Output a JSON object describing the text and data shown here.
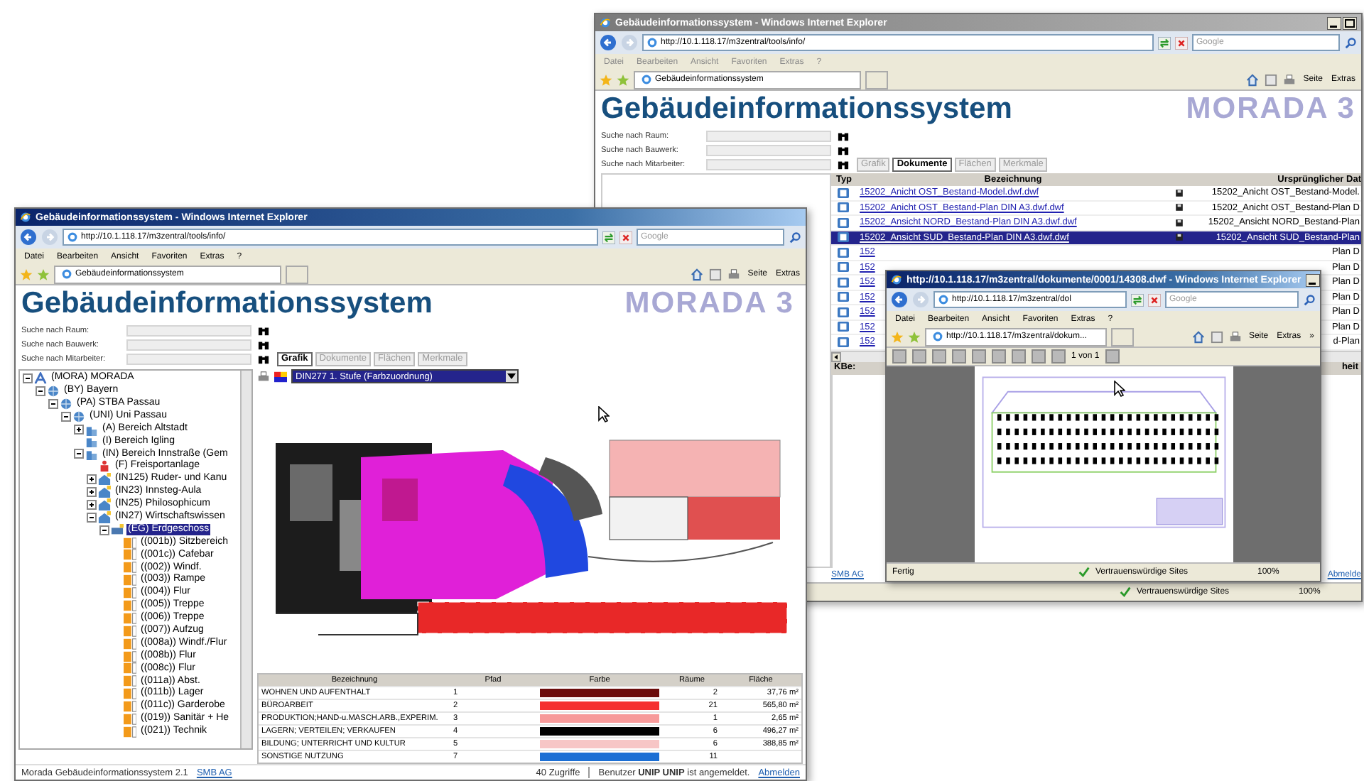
{
  "back_window": {
    "title": "Gebäudeinformationssystem - Windows Internet Explorer",
    "active": false,
    "address": "http://10.1.118.17/m3zentral/tools/info/",
    "search_placeholder": "Google",
    "menu": [
      "Datei",
      "Bearbeiten",
      "Ansicht",
      "Favoriten",
      "Extras",
      "?"
    ],
    "page_tab": "Gebäudeinformationssystem",
    "toolbar": [
      "Seite",
      "Extras"
    ],
    "page": {
      "heading": "Gebäudeinformationssystem",
      "logo": "MORADA 3",
      "search": [
        {
          "label": "Suche nach Raum:"
        },
        {
          "label": "Suche nach Bauwerk:"
        },
        {
          "label": "Suche nach Mitarbeiter:"
        }
      ],
      "tabs": [
        {
          "label": "Grafik",
          "selected": false
        },
        {
          "label": "Dokumente",
          "selected": true
        },
        {
          "label": "Flächen",
          "selected": false
        },
        {
          "label": "Merkmale",
          "selected": false
        }
      ],
      "documents": {
        "columns": [
          "Typ",
          "Bezeichnung",
          "Ursprünglicher Dat"
        ],
        "rows": [
          {
            "name": "15202_Anicht OST_Bestand-Model.dwf.dwf",
            "original": "15202_Anicht OST_Bestand-Model.",
            "selected": false
          },
          {
            "name": "15202_Anicht OST_Bestand-Plan DIN A3.dwf.dwf",
            "original": "15202_Anicht OST_Bestand-Plan D",
            "selected": false
          },
          {
            "name": "15202_Ansicht NORD_Bestand-Plan DIN A3.dwf.dwf",
            "original": "15202_Ansicht NORD_Bestand-Plan",
            "selected": false
          },
          {
            "name": "15202_Ansicht SUD_Bestand-Plan DIN A3.dwf.dwf",
            "original": "15202_Ansicht SUD_Bestand-Plan",
            "selected": true
          },
          {
            "name": "152",
            "original": "Plan D",
            "selected": false
          },
          {
            "name": "152",
            "original": "Plan D",
            "selected": false
          },
          {
            "name": "152",
            "original": "Plan D",
            "selected": false
          },
          {
            "name": "152",
            "original": "Plan D",
            "selected": false
          },
          {
            "name": "152",
            "original": "Plan D",
            "selected": false
          },
          {
            "name": "152",
            "original": "Plan D",
            "selected": false
          },
          {
            "name": "152",
            "original": "d-Plan",
            "selected": false
          }
        ]
      },
      "lower_table": {
        "columns": [
          "KBe:",
          "heit"
        ]
      },
      "footer_link": "SMB AG",
      "footer_logout": "Abmelde"
    },
    "status": {
      "zone": "Vertrauenswürdige Sites",
      "zoom": "100%"
    }
  },
  "main_window": {
    "title": "Gebäudeinformationssystem - Windows Internet Explorer",
    "active": true,
    "address": "http://10.1.118.17/m3zentral/tools/info/",
    "search_placeholder": "Google",
    "menu": [
      "Datei",
      "Bearbeiten",
      "Ansicht",
      "Favoriten",
      "Extras",
      "?"
    ],
    "page_tab": "Gebäudeinformationssystem",
    "toolbar": [
      "Seite",
      "Extras"
    ],
    "page": {
      "heading": "Gebäudeinformationssystem",
      "logo": "MORADA 3",
      "search": [
        {
          "label": "Suche nach Raum:"
        },
        {
          "label": "Suche nach Bauwerk:"
        },
        {
          "label": "Suche nach Mitarbeiter:"
        }
      ],
      "tabs": [
        {
          "label": "Grafik",
          "selected": true
        },
        {
          "label": "Dokumente",
          "selected": false
        },
        {
          "label": "Flächen",
          "selected": false
        },
        {
          "label": "Merkmale",
          "selected": false
        }
      ],
      "legend_select": "DIN277 1. Stufe (Farbzuordnung)",
      "tree": [
        {
          "label": "(MORA) MORADA",
          "kind": "root",
          "expanded": true,
          "selected": false,
          "children": [
            {
              "label": "(BY) Bayern",
              "kind": "org",
              "expanded": true,
              "selected": false,
              "children": [
                {
                  "label": "(PA) STBA Passau",
                  "kind": "org",
                  "expanded": true,
                  "selected": false,
                  "children": [
                    {
                      "label": "(UNI) Uni Passau",
                      "kind": "org",
                      "expanded": true,
                      "selected": false,
                      "children": [
                        {
                          "label": "(A) Bereich Altstadt",
                          "kind": "area",
                          "expanded": false,
                          "selected": false
                        },
                        {
                          "label": "(I) Bereich Igling",
                          "kind": "area",
                          "selected": false
                        },
                        {
                          "label": "(IN) Bereich Innstraße (Gem",
                          "kind": "area",
                          "expanded": true,
                          "selected": false,
                          "children": [
                            {
                              "label": "(F) Freisportanlage",
                              "kind": "site",
                              "selected": false
                            },
                            {
                              "label": "(IN125) Ruder- und Kanu",
                              "kind": "building",
                              "expanded": false,
                              "selected": false
                            },
                            {
                              "label": "(IN23) Innsteg-Aula",
                              "kind": "building",
                              "expanded": false,
                              "selected": false
                            },
                            {
                              "label": "(IN25) Philosophicum",
                              "kind": "building",
                              "expanded": false,
                              "selected": false
                            },
                            {
                              "label": "(IN27) Wirtschaftswissen",
                              "kind": "building",
                              "expanded": true,
                              "selected": false,
                              "children": [
                                {
                                  "label": "(EG) Erdgeschoss",
                                  "kind": "floor",
                                  "expanded": true,
                                  "selected": true,
                                  "children": [
                                    {
                                      "label": "((001b)) Sitzbereich",
                                      "kind": "room",
                                      "selected": false
                                    },
                                    {
                                      "label": "((001c)) Cafebar",
                                      "kind": "room",
                                      "selected": false
                                    },
                                    {
                                      "label": "((002)) Windf.",
                                      "kind": "room",
                                      "selected": false
                                    },
                                    {
                                      "label": "((003)) Rampe",
                                      "kind": "room",
                                      "selected": false
                                    },
                                    {
                                      "label": "((004)) Flur",
                                      "kind": "room",
                                      "selected": false
                                    },
                                    {
                                      "label": "((005)) Treppe",
                                      "kind": "room",
                                      "selected": false
                                    },
                                    {
                                      "label": "((006)) Treppe",
                                      "kind": "room",
                                      "selected": false
                                    },
                                    {
                                      "label": "((007)) Aufzug",
                                      "kind": "room",
                                      "selected": false
                                    },
                                    {
                                      "label": "((008a)) Windf./Flur",
                                      "kind": "room",
                                      "selected": false
                                    },
                                    {
                                      "label": "((008b)) Flur",
                                      "kind": "room",
                                      "selected": false
                                    },
                                    {
                                      "label": "((008c)) Flur",
                                      "kind": "room",
                                      "selected": false
                                    },
                                    {
                                      "label": "((011a)) Abst.",
                                      "kind": "room",
                                      "selected": false
                                    },
                                    {
                                      "label": "((011b)) Lager",
                                      "kind": "room",
                                      "selected": false
                                    },
                                    {
                                      "label": "((011c)) Garderobe",
                                      "kind": "room",
                                      "selected": false
                                    },
                                    {
                                      "label": "((019)) Sanitär + He",
                                      "kind": "room",
                                      "selected": false
                                    },
                                    {
                                      "label": "((021)) Technik",
                                      "kind": "room",
                                      "selected": false
                                    }
                                  ]
                                }
                              ]
                            }
                          ]
                        }
                      ]
                    }
                  ]
                }
              ]
            }
          ]
        }
      ],
      "area_table": {
        "columns": [
          "Bezeichnung",
          "Pfad",
          "Farbe",
          "Räume",
          "Fläche"
        ],
        "rows": [
          {
            "name": "WOHNEN UND AUFENTHALT",
            "path": "1",
            "color": "#6b0c0c",
            "rooms": "2",
            "area": "37,76 m²"
          },
          {
            "name": "BÜROARBEIT",
            "path": "2",
            "color": "#f53030",
            "rooms": "21",
            "area": "565,80 m²"
          },
          {
            "name": "PRODUKTION;HAND-u.MASCH.ARB.,EXPERIM.",
            "path": "3",
            "color": "#f79a9a",
            "rooms": "1",
            "area": "2,65 m²"
          },
          {
            "name": "LAGERN; VERTEILEN; VERKAUFEN",
            "path": "4",
            "color": "#000000",
            "rooms": "6",
            "area": "496,27 m²"
          },
          {
            "name": "BILDUNG; UNTERRICHT UND KULTUR",
            "path": "5",
            "color": "#f7c6c6",
            "rooms": "6",
            "area": "388,85 m²"
          },
          {
            "name": "SONSTIGE NUTZUNG",
            "path": "7",
            "color": "#1c6fd4",
            "rooms": "11"
          }
        ]
      },
      "footer_title": "Morada Gebäudeinformationssystem 2.1",
      "footer_link": "SMB AG",
      "footer_hits": "40 Zugriffe",
      "footer_user": "Benutzer **UNIP UNIP** ist angemeldet.",
      "footer_logout": "Abmelden"
    }
  },
  "viewer_window": {
    "title": "http://10.1.118.17/m3zentral/dokumente/0001/14308.dwf - Windows Internet Explorer",
    "active": true,
    "address": "http://10.1.118.17/m3zentral/dol",
    "search_placeholder": "Google",
    "menu": [
      "Datei",
      "Bearbeiten",
      "Ansicht",
      "Favoriten",
      "Extras",
      "?"
    ],
    "page_tab": "http://10.1.118.17/m3zentral/dokum...",
    "toolbar": [
      "Seite",
      "Extras",
      "»"
    ],
    "viewer": {
      "page_info": "1 von 1"
    },
    "status": {
      "text": "Fertig",
      "zone": "Vertrauenswürdige Sites",
      "zoom": "100%"
    }
  }
}
